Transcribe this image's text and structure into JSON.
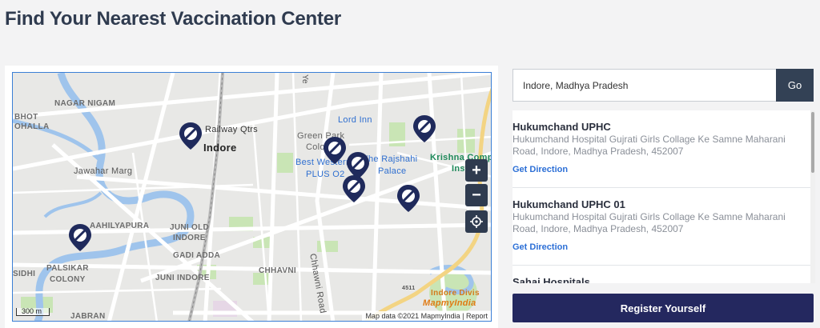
{
  "page": {
    "title": "Find Your Nearest Vaccination Center"
  },
  "map": {
    "labels": {
      "nagar_nigam": "NAGAR NIGAM",
      "bhot": "BHOT",
      "ohalla": "OHALLA",
      "railway_qtrs": "Railway Qtrs",
      "indore": "Indore",
      "jawahar_marg": "Jawahar Marg",
      "lord_inn": "Lord Inn",
      "green_park": "Green Park",
      "colony": "Colo",
      "best_western": "Best Western",
      "plus_o2": "PLUS O2",
      "rajshahi": "The Rajshahi",
      "palace": "Palace",
      "krishna": "Krishna Comp",
      "insti": "Insti",
      "aahilyapura": "AAHILYAPURA",
      "juni_old": "JUNI OLD",
      "indore_caps": "INDORE",
      "gadi_adda": "GADI ADDA",
      "juni_indore": "JUNI INDORE",
      "chhavni": "CHHAVNI",
      "chhawni_road": "Chhawni Road",
      "palsikar": "PALSIKAR",
      "colony_caps": "COLONY",
      "sidhi": "SIDHI",
      "jabran": "JABRAN",
      "indore_divis": "Indore Divis",
      "road_num": "4511",
      "mapmyindia": "MapmyIndia",
      "ye": "Ye"
    },
    "zoom_in": "+",
    "zoom_out": "−",
    "locate_icon": "crosshair-icon",
    "pin_icon": "vaccine-marker-icon",
    "scale": "300 m",
    "attribution": "Map data ©2021 MapmyIndia",
    "attribution_sep": " | ",
    "report": "Report"
  },
  "search": {
    "value": "Indore, Madhya Pradesh",
    "button": "Go"
  },
  "results": [
    {
      "name": "Hukumchand UPHC",
      "address": "Hukumchand Hospital Gujrati Girls Collage Ke Samne Maharani Road, Indore, Madhya Pradesh, 452007",
      "direction": "Get Direction"
    },
    {
      "name": "Hukumchand UPHC 01",
      "address": "Hukumchand Hospital Gujrati Girls Collage Ke Samne Maharani Road, Indore, Madhya Pradesh, 452007",
      "direction": "Get Direction"
    },
    {
      "name": "Sahai Hospitals",
      "address": "",
      "direction": ""
    }
  ],
  "register": {
    "label": "Register Yourself"
  },
  "colors": {
    "accent": "#24285f",
    "go_button": "#334155",
    "link": "#2c6fd6",
    "marker": "#1f2a5c"
  }
}
